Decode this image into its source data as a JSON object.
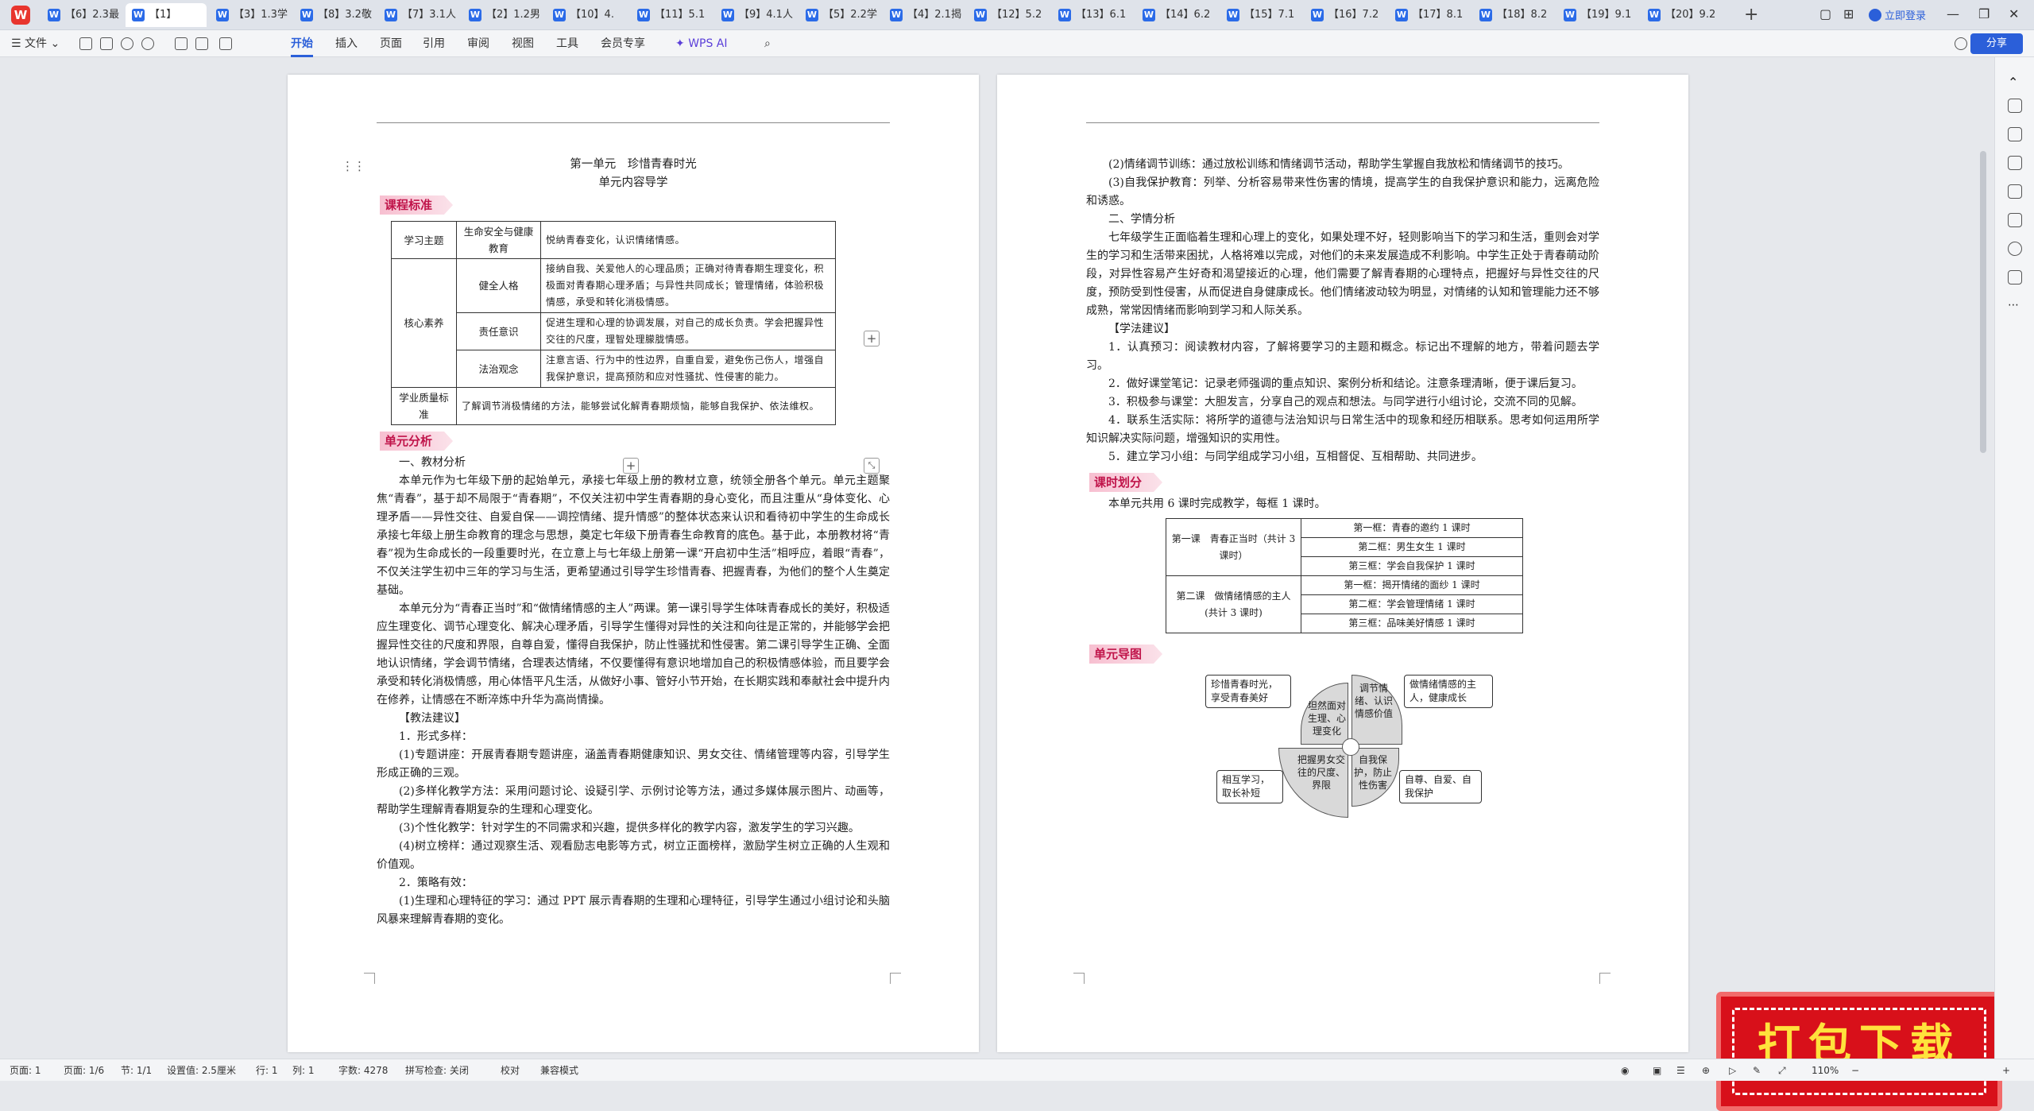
{
  "tabs": [
    {
      "label": "【6】2.3最"
    },
    {
      "label": "【1】"
    },
    {
      "label": "【3】1.3学"
    },
    {
      "label": "【8】3.2敬"
    },
    {
      "label": "【7】3.1人"
    },
    {
      "label": "【2】1.2男"
    },
    {
      "label": "【10】4."
    },
    {
      "label": "【11】5.1"
    },
    {
      "label": "【9】4.1人"
    },
    {
      "label": "【5】2.2学"
    },
    {
      "label": "【4】2.1揭"
    },
    {
      "label": "【12】5.2"
    },
    {
      "label": "【13】6.1"
    },
    {
      "label": "【14】6.2"
    },
    {
      "label": "【15】7.1"
    },
    {
      "label": "【16】7.2"
    },
    {
      "label": "【17】8.1"
    },
    {
      "label": "【18】8.2"
    },
    {
      "label": "【19】9.1"
    },
    {
      "label": "【20】9.2"
    }
  ],
  "login_label": "立即登录",
  "menu": {
    "file": "文件",
    "items": [
      "开始",
      "插入",
      "页面",
      "引用",
      "审阅",
      "视图",
      "工具",
      "会员专享"
    ],
    "ai": "WPS AI",
    "share": "分享"
  },
  "page1": {
    "title1": "第一单元　珍惜青春时光",
    "title2": "单元内容导学",
    "sect_standard": "课程标准",
    "table": {
      "r1_c1": "学习主题",
      "r1_c2": "生命安全与健康教育",
      "r1_c3": "悦纳青春变化，认识情绪情感。",
      "core": "核心素养",
      "r2_c2": "健全人格",
      "r2_c3": "接纳自我、关爱他人的心理品质；正确对待青春期生理变化，积极面对青春期心理矛盾；与异性共同成长；管理情绪，体验积极情感，承受和转化消极情感。",
      "r3_c2": "责任意识",
      "r3_c3": "促进生理和心理的协调发展，对自己的成长负责。学会把握异性交往的尺度，理智处理朦胧情感。",
      "r4_c2": "法治观念",
      "r4_c3": "注意言语、行为中的性边界，自重自爱，避免伤己伤人，增强自我保护意识，提高预防和应对性骚扰、性侵害的能力。",
      "r5_c1": "学业质量标准",
      "r5_c3": "了解调节消极情绪的方法，能够尝试化解青春期烦恼，能够自我保护、依法维权。"
    },
    "sect_analysis": "单元分析",
    "h_material": "一、教材分析",
    "p1": "本单元作为七年级下册的起始单元，承接七年级上册的教材立意，统领全册各个单元。单元主题聚焦“青春”，基于却不局限于“青春期”，不仅关注初中学生青春期的身心变化，而且注重从“身体变化、心理矛盾——异性交往、自爱自保——调控情绪、提升情感”的整体状态来认识和看待初中学生的生命成长承接七年级上册生命教育的理念与思想，奠定七年级下册青春生命教育的底色。基于此，本册教材将“青春”视为生命成长的一段重要时光，在立意上与七年级上册第一课“开启初中生活”相呼应，着眼“青春”，不仅关注学生初中三年的学习与生活，更希望通过引导学生珍惜青春、把握青春，为他们的整个人生奠定基础。",
    "p2": "本单元分为“青春正当时”和“做情绪情感的主人”两课。第一课引导学生体味青春成长的美好，积极适应生理变化、调节心理变化、解决心理矛盾，引导学生懂得对异性的关注和向往是正常的，并能够学会把握异性交往的尺度和界限，自尊自爱，懂得自我保护，防止性骚扰和性侵害。第二课引导学生正确、全面地认识情绪，学会调节情绪，合理表达情绪，不仅要懂得有意识地增加自己的积极情感体验，而且要学会承受和转化消极情感，用心体悟平凡生活，从做好小事、管好小节开始，在长期实践和奉献社会中提升内在修养，让情感在不断淬炼中升华为高尚情操。",
    "h_teach": "【教法建议】",
    "t1": "1．形式多样：",
    "t1a": "(1)专题讲座：开展青春期专题讲座，涵盖青春期健康知识、男女交往、情绪管理等内容，引导学生形成正确的三观。",
    "t1b": "(2)多样化教学方法：采用问题讨论、设疑引学、示例讨论等方法，通过多媒体展示图片、动画等，帮助学生理解青春期复杂的生理和心理变化。",
    "t1c": "(3)个性化教学：针对学生的不同需求和兴趣，提供多样化的教学内容，激发学生的学习兴趣。",
    "t1d": "(4)树立榜样：通过观察生活、观看励志电影等方式，树立正面榜样，激励学生树立正确的人生观和价值观。",
    "t2": "2．策略有效：",
    "t2a": "(1)生理和心理特征的学习：通过 PPT 展示青春期的生理和心理特征，引导学生通过小组讨论和头脑风暴来理解青春期的变化。"
  },
  "page2": {
    "q2": "(2)情绪调节训练：通过放松训练和情绪调节活动，帮助学生掌握自我放松和情绪调节的技巧。",
    "q3": "(3)自我保护教育：列举、分析容易带来性伤害的情境，提高学生的自我保护意识和能力，远离危险和诱惑。",
    "h_learner": "二、学情分析",
    "p_learner": "七年级学生正面临着生理和心理上的变化，如果处理不好，轻则影响当下的学习和生活，重则会对学生的学习和生活带来困扰，人格将难以完成，对他们的未来发展造成不利影响。中学生正处于青春萌动阶段，对异性容易产生好奇和渴望接近的心理，他们需要了解青春期的心理特点，把握好与异性交往的尺度，预防受到性侵害，从而促进自身健康成长。他们情绪波动较为明显，对情绪的认知和管理能力还不够成熟，常常因情绪而影响到学习和人际关系。",
    "h_method": "【学法建议】",
    "m1": "1．认真预习：阅读教材内容，了解将要学习的主题和概念。标记出不理解的地方，带着问题去学习。",
    "m2": "2．做好课堂笔记：记录老师强调的重点知识、案例分析和结论。注意条理清晰，便于课后复习。",
    "m3": "3．积极参与课堂：大胆发言，分享自己的观点和想法。与同学进行小组讨论，交流不同的见解。",
    "m4": "4．联系生活实际：将所学的道德与法治知识与日常生活中的现象和经历相联系。思考如何运用所学知识解决实际问题，增强知识的实用性。",
    "m5": "5．建立学习小组：与同学组成学习小组，互相督促、互相帮助、共同进步。",
    "sect_time": "课时划分",
    "time_intro": "本单元共用 6 课时完成教学，每框 1 课时。",
    "plan": {
      "lesson1": "第一课　青春正当时（共计 3 课时）",
      "l1k1": "第一框：青春的邀约 1 课时",
      "l1k2": "第二框：男生女生 1 课时",
      "l1k3": "第三框：学会自我保护 1 课时",
      "lesson2": "第二课　做情绪情感的主人(共计 3 课时)",
      "l2k1": "第一框：揭开情绪的面纱 1 课时",
      "l2k2": "第二框：学会管理情绪 1 课时",
      "l2k3": "第三框：品味美好情感 1 课时"
    },
    "sect_map": "单元导图",
    "map": {
      "tl": "珍惜青春时光，享受青春美好",
      "tr": "做情绪情感的主人，健康成长",
      "bl": "相互学习，取长补短",
      "br": "自尊、自爱、自我保护",
      "q_tl": "坦然面对生理、心理变化",
      "q_tr": "调节情绪、认识情感价值",
      "q_bl": "把握男女交往的尺度、界限",
      "q_br": "自我保护，防止性伤害"
    }
  },
  "promo": "打包下载",
  "status": {
    "page": "页面: 1",
    "pages": "页面: 1/6",
    "section": "节: 1/1",
    "setting": "设置值: 2.5厘米",
    "row": "行: 1",
    "col": "列: 1",
    "words": "字数: 4278",
    "spell": "拼写检查: 关闭",
    "proof": "校对",
    "compat": "兼容模式",
    "zoom": "110%"
  }
}
